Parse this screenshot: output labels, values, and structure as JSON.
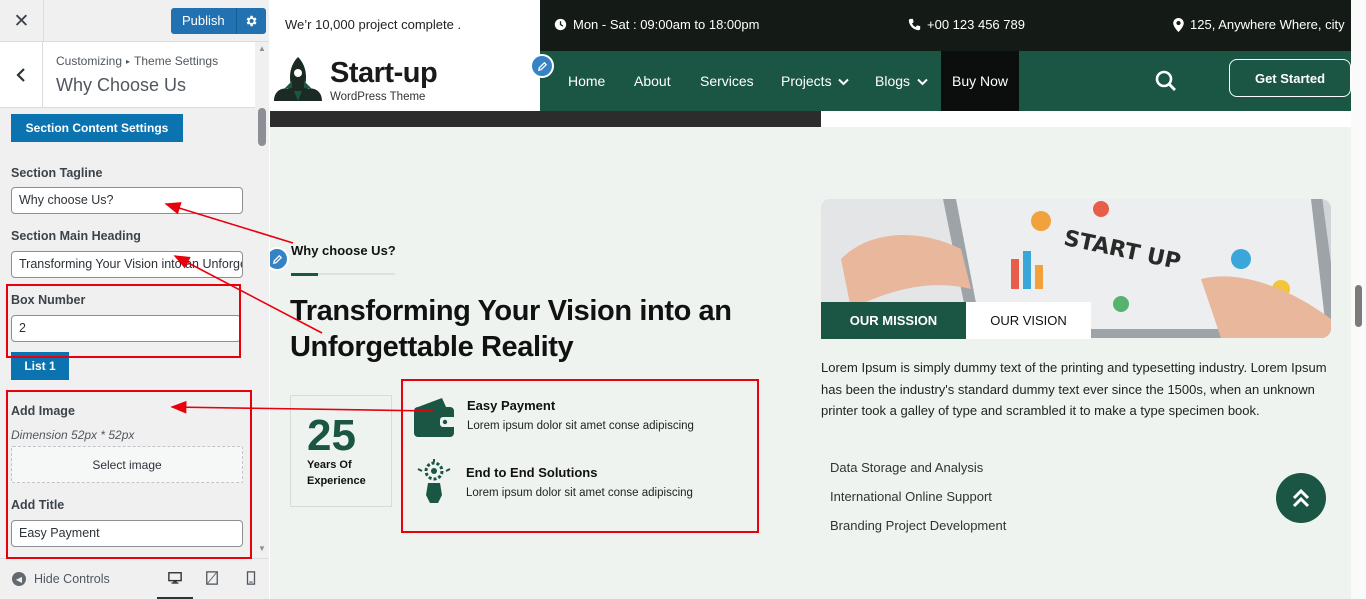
{
  "customizer": {
    "close_glyph": "✕",
    "publish_label": "Publish",
    "back_glyph": "‹",
    "breadcrumb": {
      "root": "Customizing",
      "separator": "▸",
      "parent": "Theme Settings"
    },
    "section_title": "Why Choose Us",
    "section_content_button": "Section Content Settings",
    "fields": {
      "tagline": {
        "label": "Section Tagline",
        "value": "Why choose Us?"
      },
      "main_heading": {
        "label": "Section Main Heading",
        "value": "Transforming Your Vision into an Unforgettable Reality"
      },
      "box_number": {
        "label": "Box Number",
        "value": "2"
      },
      "list_button": "List 1",
      "add_image": {
        "label": "Add Image",
        "dimension_note": "Dimension 52px * 52px",
        "select_button": "Select image"
      },
      "add_title": {
        "label": "Add Title",
        "value": "Easy Payment"
      }
    },
    "footer": {
      "hide_controls": "Hide Controls",
      "devices": [
        "desktop-icon",
        "tablet-icon",
        "mobile-icon"
      ],
      "active_device": "desktop"
    }
  },
  "site": {
    "topbar": {
      "project_text": "We’r 10,000 project complete .",
      "hours": "Mon - Sat : 09:00am to 18:00pm",
      "phone": "+00 123 456 789",
      "address": "125, Anywhere Where, city"
    },
    "logo": {
      "title": "Start-up",
      "subtitle": "WordPress Theme"
    },
    "nav": {
      "items": [
        {
          "label": "Home",
          "dropdown": false
        },
        {
          "label": "About",
          "dropdown": false
        },
        {
          "label": "Services",
          "dropdown": false
        },
        {
          "label": "Projects",
          "dropdown": true
        },
        {
          "label": "Blogs",
          "dropdown": true
        }
      ],
      "buy_now": "Buy Now",
      "cta": "Get Started"
    },
    "why_choose": {
      "tagline": "Why choose Us?",
      "heading": "Transforming Your Vision into an Unforgettable Reality",
      "years_number": "25",
      "years_label": "Years Of Experience",
      "features": [
        {
          "title": "Easy Payment",
          "desc": "Lorem ipsum dolor sit amet conse adipiscing",
          "icon": "wallet-icon"
        },
        {
          "title": "End to End Solutions",
          "desc": "Lorem ipsum dolor sit amet conse adipiscing",
          "icon": "hand-gear-icon"
        }
      ],
      "tabs": {
        "mission": "OUR MISSION",
        "vision": "OUR VISION",
        "active": "mission"
      },
      "image_text": "START UP",
      "paragraph": "Lorem Ipsum is simply dummy text of the printing and typesetting industry. Lorem Ipsum has been the industry's standard dummy text ever since the 1500s, when an unknown printer took a galley of type and scrambled it to make a type specimen book.",
      "bullets": [
        "Data Storage and Analysis",
        "International Online Support",
        "Branding Project Development"
      ]
    }
  },
  "colors": {
    "wp_blue": "#2271b1",
    "brand_green": "#1b5544",
    "topbar_dark": "#141a16",
    "annotation_red": "#e8000d",
    "section_bg": "#eef3f0"
  }
}
